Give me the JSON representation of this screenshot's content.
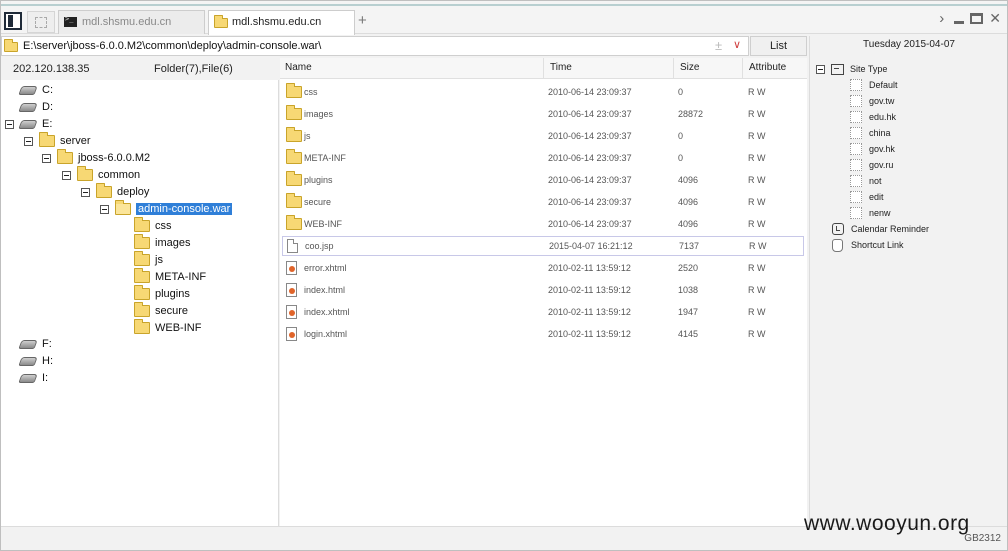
{
  "tabs": [
    {
      "title": "mdl.shsmu.edu.cn",
      "active": false,
      "icon": "terminal-icon"
    },
    {
      "title": "mdl.shsmu.edu.cn",
      "active": true,
      "icon": "folder-icon"
    }
  ],
  "new_tab_label": "+",
  "address": {
    "path": "E:\\server\\jboss-6.0.0.M2\\common\\deploy\\admin-console.war\\",
    "plus": "±",
    "dropdown": "∨"
  },
  "list_button": "List",
  "left_header": {
    "ip": "202.120.138.35",
    "count": "Folder(7),File(6)"
  },
  "tree": [
    {
      "label": "C:",
      "type": "drive"
    },
    {
      "label": "D:",
      "type": "drive"
    },
    {
      "label": "E:",
      "type": "drive"
    },
    {
      "label": "server",
      "type": "folder"
    },
    {
      "label": "jboss-6.0.0.M2",
      "type": "folder"
    },
    {
      "label": "common",
      "type": "folder"
    },
    {
      "label": "deploy",
      "type": "folder"
    },
    {
      "label": "admin-console.war",
      "type": "folder-open"
    },
    {
      "label": "css",
      "type": "folder"
    },
    {
      "label": "images",
      "type": "folder"
    },
    {
      "label": "js",
      "type": "folder"
    },
    {
      "label": "META-INF",
      "type": "folder"
    },
    {
      "label": "plugins",
      "type": "folder"
    },
    {
      "label": "secure",
      "type": "folder"
    },
    {
      "label": "WEB-INF",
      "type": "folder"
    },
    {
      "label": "F:",
      "type": "drive"
    },
    {
      "label": "H:",
      "type": "drive"
    },
    {
      "label": "I:",
      "type": "drive"
    }
  ],
  "columns": {
    "name": "Name",
    "time": "Time",
    "size": "Size",
    "attribute": "Attribute"
  },
  "files": [
    {
      "name": "css",
      "time": "2010-06-14 23:09:37",
      "size": "0",
      "attr": "R W",
      "kind": "folder"
    },
    {
      "name": "images",
      "time": "2010-06-14 23:09:37",
      "size": "28872",
      "attr": "R W",
      "kind": "folder"
    },
    {
      "name": "js",
      "time": "2010-06-14 23:09:37",
      "size": "0",
      "attr": "R W",
      "kind": "folder"
    },
    {
      "name": "META-INF",
      "time": "2010-06-14 23:09:37",
      "size": "0",
      "attr": "R W",
      "kind": "folder"
    },
    {
      "name": "plugins",
      "time": "2010-06-14 23:09:37",
      "size": "4096",
      "attr": "R W",
      "kind": "folder"
    },
    {
      "name": "secure",
      "time": "2010-06-14 23:09:37",
      "size": "4096",
      "attr": "R W",
      "kind": "folder"
    },
    {
      "name": "WEB-INF",
      "time": "2010-06-14 23:09:37",
      "size": "4096",
      "attr": "R W",
      "kind": "folder"
    },
    {
      "name": "coo.jsp",
      "time": "2015-04-07 16:21:12",
      "size": "7137",
      "attr": "R W",
      "kind": "file"
    },
    {
      "name": "error.xhtml",
      "time": "2010-02-11 13:59:12",
      "size": "2520",
      "attr": "R W",
      "kind": "html"
    },
    {
      "name": "index.html",
      "time": "2010-02-11 13:59:12",
      "size": "1038",
      "attr": "R W",
      "kind": "html"
    },
    {
      "name": "index.xhtml",
      "time": "2010-02-11 13:59:12",
      "size": "1947",
      "attr": "R W",
      "kind": "html"
    },
    {
      "name": "login.xhtml",
      "time": "2010-02-11 13:59:12",
      "size": "4145",
      "attr": "R W",
      "kind": "html"
    }
  ],
  "right_panel": {
    "date": "Tuesday 2015-04-07",
    "site_type": "Site Type",
    "site_items": [
      "Default",
      "gov.tw",
      "edu.hk",
      "china",
      "gov.hk",
      "gov.ru",
      "not",
      "edit",
      "nenw"
    ],
    "calendar": "Calendar Reminder",
    "shortcut": "Shortcut Link"
  },
  "watermark": "www.wooyun.org",
  "status": {
    "encoding": "GB2312"
  },
  "colors": {
    "selection": "#2f7fd8",
    "folder": "#f7d874",
    "accent_line": "#b8cfd0"
  }
}
